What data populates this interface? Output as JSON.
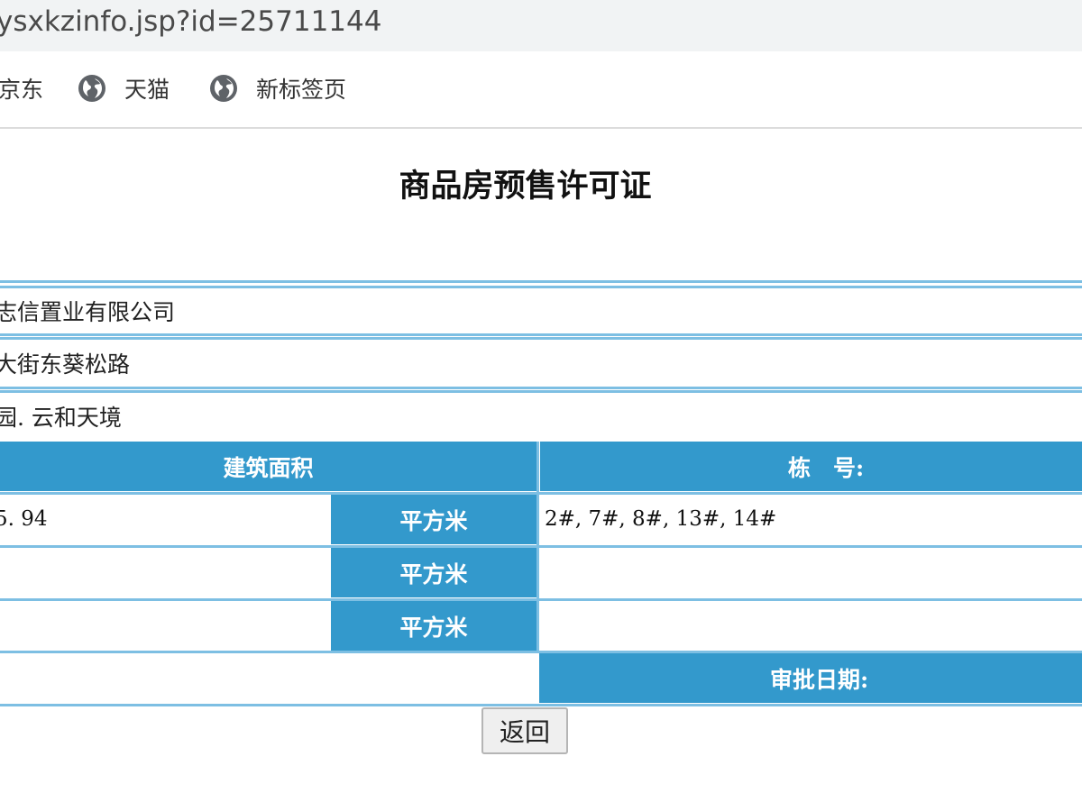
{
  "browser": {
    "url": "ysxkzinfo.jsp?id=25711144",
    "bookmarks": [
      {
        "label": "京东",
        "icon": "globe-icon"
      },
      {
        "label": "天猫",
        "icon": "globe-icon"
      },
      {
        "label": "新标签页",
        "icon": "globe-icon"
      }
    ]
  },
  "page": {
    "title": "商品房预售许可证",
    "company": "志信置业有限公司",
    "address": "大街东葵松路",
    "project": "园. 云和天境",
    "headers": {
      "area": "建筑面积",
      "building_no": "栋　号:",
      "approval_date": "审批日期:"
    },
    "area_rows": [
      {
        "value": "5. 94",
        "unit": "平方米",
        "buildings": "2#, 7#, 8#, 13#, 14#"
      },
      {
        "value": "",
        "unit": "平方米",
        "buildings": ""
      },
      {
        "value": "",
        "unit": "平方米",
        "buildings": ""
      }
    ],
    "approval_date_value": "",
    "back_button": "返回"
  },
  "colors": {
    "header_blue": "#3399cc",
    "border_light_blue": "#7dbfe3"
  }
}
